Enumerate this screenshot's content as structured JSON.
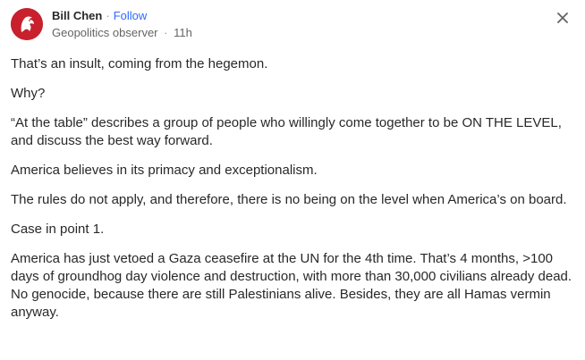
{
  "author": {
    "name": "Bill Chen",
    "follow_label": "Follow",
    "separator": "·",
    "credential": "Geopolitics observer",
    "time": "11h",
    "avatar_icon": "lion-logo-icon",
    "avatar_color": "#c8202c"
  },
  "close_icon": "close-icon",
  "paragraphs": [
    "That’s an insult, coming from the hegemon.",
    "Why?",
    "“At the table” describes a group of people who willingly come together to be ON THE LEVEL, and discuss the best way forward.",
    "America believes in its primacy and exceptionalism.",
    "The rules do not apply, and therefore, there is no being on the level when America’s on board.",
    "Case in point 1.",
    "America has just vetoed a Gaza ceasefire at the UN for the 4th time. That’s 4 months, >100 days of groundhog day violence and destruction, with more than 30,000 civilians already dead. No genocide, because there are still Palestinians alive. Besides, they are all Hamas vermin anyway."
  ],
  "colors": {
    "link": "#2e69ff",
    "text": "#282829",
    "muted": "#636466"
  }
}
